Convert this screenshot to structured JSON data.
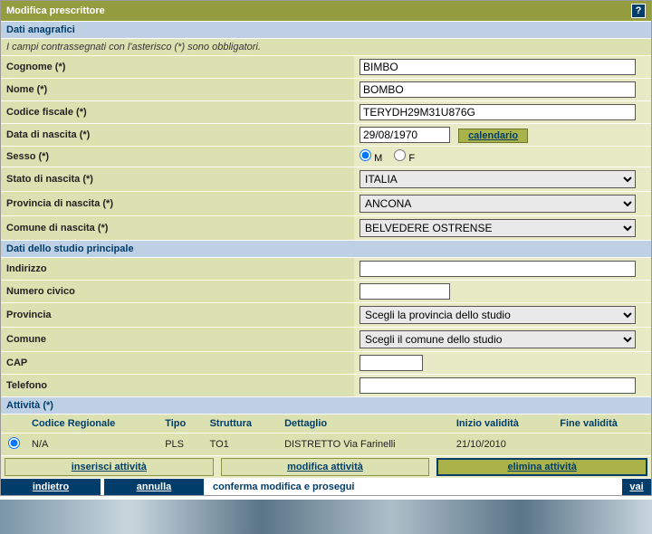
{
  "title": "Modifica prescrittore",
  "help": "?",
  "sections": {
    "anagrafica": "Dati anagrafici",
    "note": "I campi contrassegnati con l'asterisco (*) sono obbligatori.",
    "studio": "Dati dello studio principale",
    "attivita": "Attività (*)"
  },
  "labels": {
    "cognome": "Cognome (*)",
    "nome": "Nome (*)",
    "cf": "Codice fiscale (*)",
    "nascita": "Data di nascita (*)",
    "sesso": "Sesso (*)",
    "stato": "Stato di nascita (*)",
    "provincia": "Provincia di nascita (*)",
    "comune": "Comune di nascita (*)",
    "indirizzo": "Indirizzo",
    "civico": "Numero civico",
    "provinciaStudio": "Provincia",
    "comuneStudio": "Comune",
    "cap": "CAP",
    "telefono": "Telefono"
  },
  "values": {
    "cognome": "BIMBO",
    "nome": "BOMBO",
    "cf": "TERYDH29M31U876G",
    "nascita": "29/08/1970",
    "calendario": "calendario",
    "sessoM": "M",
    "sessoF": "F",
    "stato": "ITALIA",
    "provincia": "ANCONA",
    "comune": "BELVEDERE OSTRENSE",
    "indirizzo": "",
    "civico": "",
    "provinciaStudio": "Scegli la provincia dello studio",
    "comuneStudio": "Scegli il comune dello studio",
    "cap": "",
    "telefono": ""
  },
  "activityHeaders": {
    "codice": "Codice Regionale",
    "tipo": "Tipo",
    "struttura": "Struttura",
    "dettaglio": "Dettaglio",
    "inizio": "Inizio validità",
    "fine": "Fine validità"
  },
  "activityRow": {
    "codice": "N/A",
    "tipo": "PLS",
    "struttura": "TO1",
    "dettaglio": "DISTRETTO Via Farinelli",
    "inizio": "21/10/2010",
    "fine": ""
  },
  "activityButtons": {
    "inserisci": "inserisci attività",
    "modifica": "modifica attività",
    "elimina": "elimina attività"
  },
  "bottom": {
    "indietro": "indietro",
    "annulla": "annulla",
    "conferma": "conferma modifica e prosegui",
    "vai": "vai"
  }
}
